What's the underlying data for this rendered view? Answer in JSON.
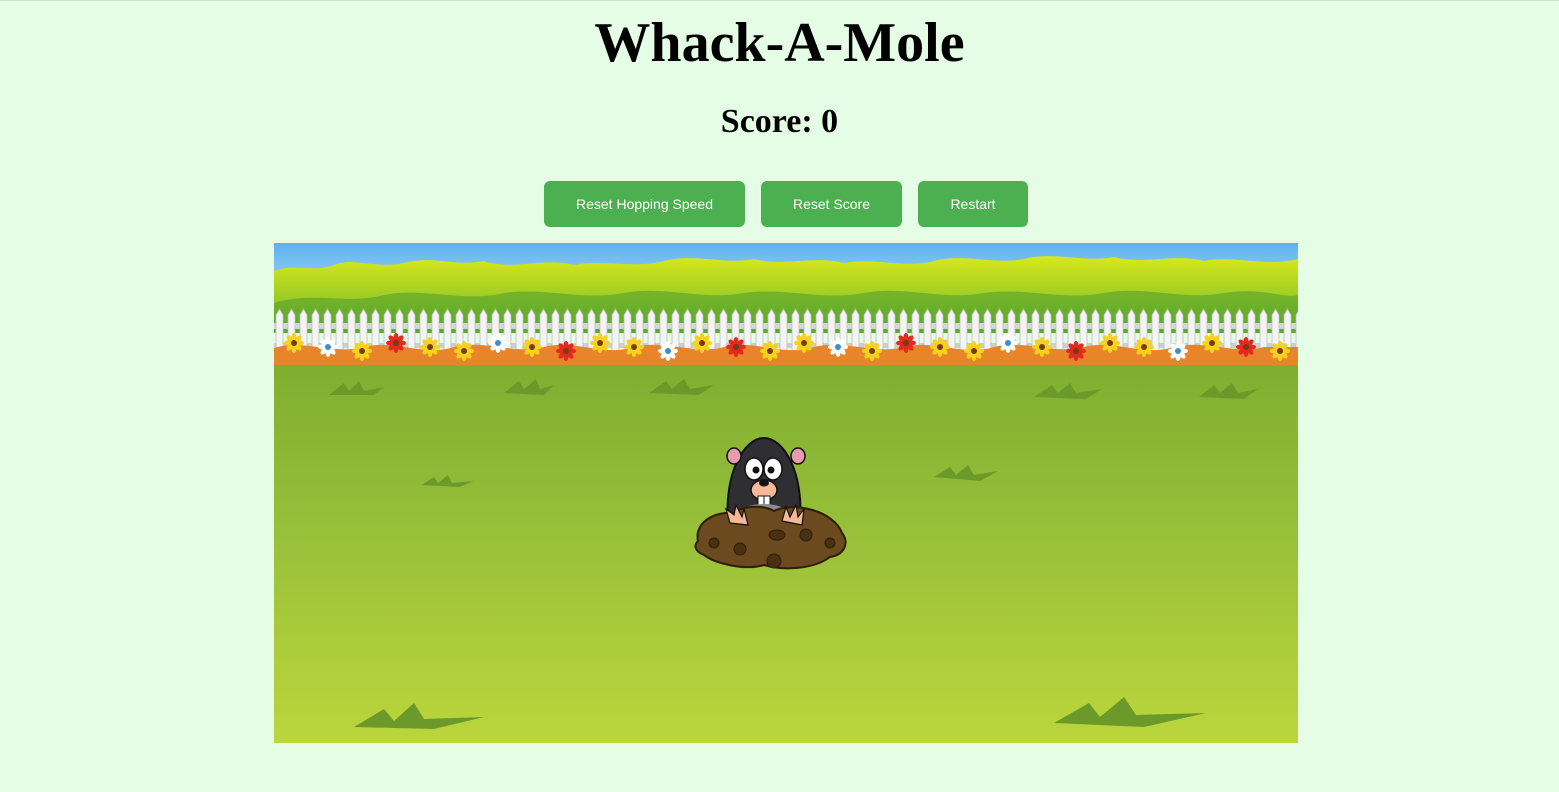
{
  "title": "Whack-A-Mole",
  "score": {
    "label": "Score:",
    "value": "0",
    "display": "Score: 0"
  },
  "controls": {
    "reset_speed_label": "Reset Hopping Speed",
    "reset_score_label": "Reset Score",
    "restart_label": "Restart"
  },
  "colors": {
    "page_background": "#e5fde5",
    "button_background": "#4caf50",
    "button_text": "#ffffff",
    "sky": "#6ec1f5",
    "grass": "#8dbb36",
    "mole_body": "#2e2e33",
    "dirt": "#6b4a1f"
  },
  "board": {
    "scene": "garden-lawn",
    "mole_visible": true
  }
}
